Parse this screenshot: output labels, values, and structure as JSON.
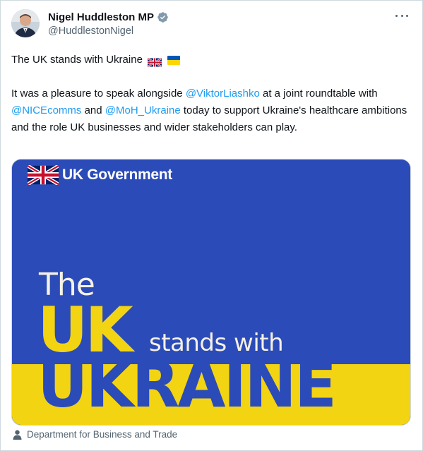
{
  "author": {
    "name": "Nigel Huddleston MP",
    "handle": "@HuddlestonNigel",
    "verified_icon": "verified-badge-icon"
  },
  "tweet": {
    "line1": "The UK stands with Ukraine",
    "para_parts": {
      "p1": "It was a pleasure to speak alongside ",
      "m1": "@ViktorLiashko",
      "p2": " at a joint roundtable with ",
      "m2": "@NICEcomms",
      "p3": " and ",
      "m3": "@MoH_Ukraine",
      "p4": " today to support Ukraine's healthcare ambitions and the role UK businesses and wider stakeholders can play."
    }
  },
  "media": {
    "logo_text": "UK Government",
    "word_the": "The",
    "word_uk": "UK",
    "words_stands": "stands with",
    "word_ukraine": "UKRAINE",
    "colors": {
      "blue": "#2b4bb8",
      "yellow": "#f2d413"
    }
  },
  "attribution": {
    "text": "Department for Business and Trade",
    "icon": "person-icon"
  },
  "colors": {
    "link": "#1d9bf0",
    "muted": "#536471",
    "text": "#0f1419"
  }
}
